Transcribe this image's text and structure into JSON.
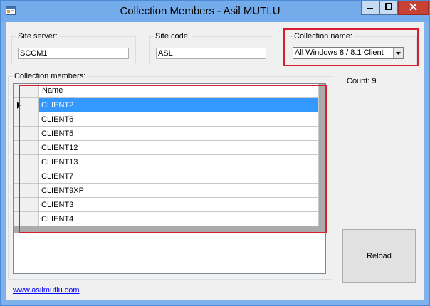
{
  "window": {
    "title": "Collection Members - Asil MUTLU"
  },
  "icons": {
    "app": "app-window-icon",
    "minimize": "minimize-icon",
    "maximize": "maximize-icon",
    "close": "close-icon",
    "dropdown": "chevron-down-icon",
    "row_pointer": "row-pointer-icon"
  },
  "site_server": {
    "label": "Site server:",
    "value": "SCCM1"
  },
  "site_code": {
    "label": "Site code:",
    "value": "ASL"
  },
  "collection_name": {
    "label": "Collection name:",
    "selected": "All Windows 8 / 8.1 Client"
  },
  "members": {
    "label": "Collection members:",
    "column_header": "Name",
    "rows": [
      "CLIENT2",
      "CLIENT6",
      "CLIENT5",
      "CLIENT12",
      "CLIENT13",
      "CLIENT7",
      "CLIENT9XP",
      "CLIENT3",
      "CLIENT4"
    ],
    "selected_index": 0
  },
  "count": {
    "text": "Count: 9"
  },
  "reload_label": "Reload",
  "link_text": "www.asilmutlu.com",
  "colors": {
    "title_bar": "#74aceb",
    "close_button": "#c74134",
    "selection": "#3399ff",
    "highlight_box": "#d6202e",
    "link": "#0000ff"
  }
}
